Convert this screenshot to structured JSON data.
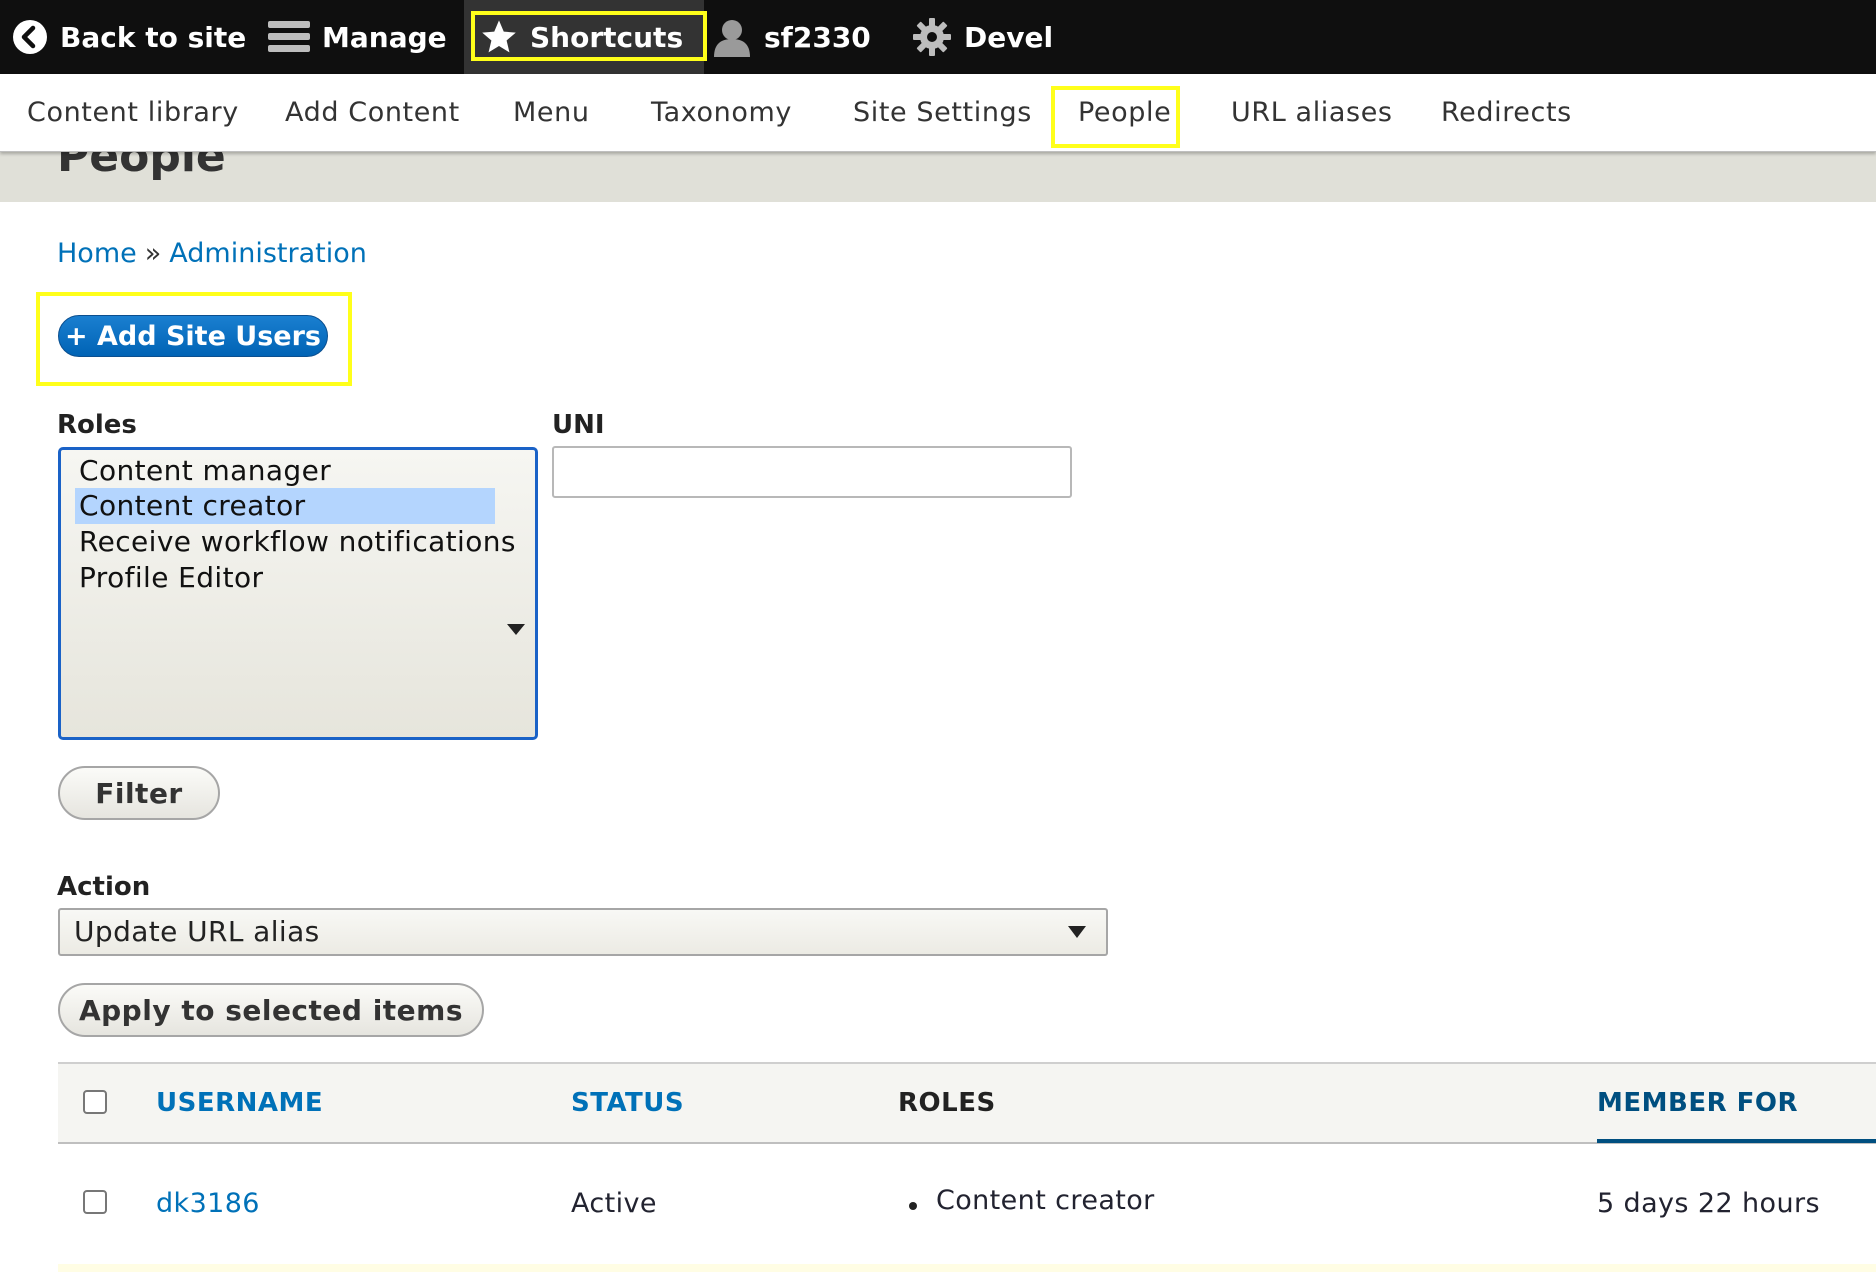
{
  "toolbar": {
    "back": "Back to site",
    "manage": "Manage",
    "shortcuts": "Shortcuts",
    "user": "sf2330",
    "devel": "Devel"
  },
  "tray": {
    "items": [
      "Content library",
      "Add Content",
      "Menu",
      "Taxonomy",
      "Site Settings",
      "People",
      "URL aliases",
      "Redirects"
    ]
  },
  "page": {
    "title": "People"
  },
  "breadcrumb": {
    "home": "Home",
    "separator": "»",
    "admin": "Administration"
  },
  "add_button": "+ Add Site Users",
  "filters": {
    "roles_label": "Roles",
    "roles_options": [
      "Content manager",
      "Content creator",
      "Receive workflow notifications",
      "Profile Editor"
    ],
    "roles_selected": "Content creator",
    "uni_label": "UNI",
    "uni_value": "",
    "filter_button": "Filter"
  },
  "bulk": {
    "action_label": "Action",
    "action_value": "Update URL alias",
    "apply_button": "Apply to selected items"
  },
  "table": {
    "columns": [
      "USERNAME",
      "STATUS",
      "ROLES",
      "MEMBER FOR"
    ],
    "rows": [
      {
        "username": "dk3186",
        "status": "Active",
        "roles": [
          "Content creator"
        ],
        "member_for": "5 days 22 hours"
      }
    ]
  },
  "colors": {
    "toolbar_bg": "#0f0f0f",
    "highlight": "#ffff1a",
    "link": "#0071b8",
    "primary_button": "#0072c6",
    "selected_option": "#b4d5fe"
  }
}
